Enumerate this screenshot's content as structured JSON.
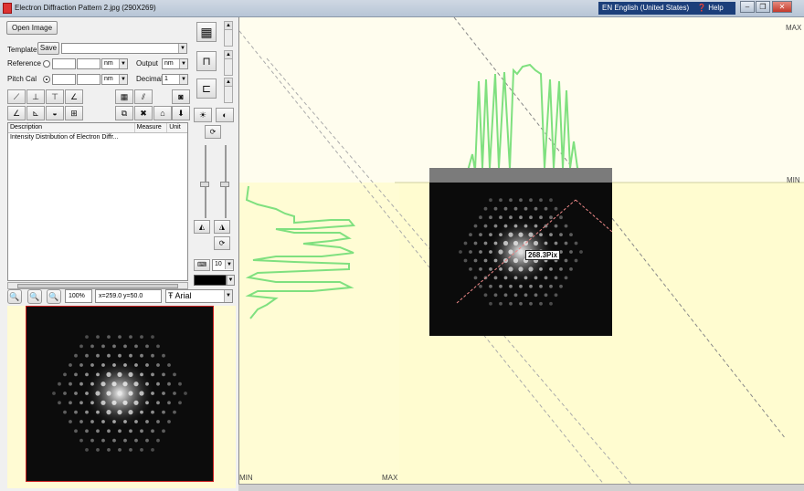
{
  "window": {
    "title": "Electron Diffraction Pattern 2.jpg  (290X269)",
    "language": "EN English (United States)",
    "help": "Help"
  },
  "panel": {
    "open_image": "Open Image",
    "template_label": "Template",
    "save_label": "Save",
    "template_value": "",
    "reference_label": "Reference",
    "reference_unit": "nm",
    "output_label": "Output",
    "output_unit": "nm",
    "pitch_label": "Pitch Cal",
    "pitch_unit": "nm",
    "decimal_label": "Decimal",
    "decimal_value": "1"
  },
  "table": {
    "columns": [
      "Description",
      "Measure",
      "Unit"
    ],
    "rows": [
      {
        "description": "Intensity Distribution of Electron Diffr...",
        "measure": "",
        "unit": ""
      }
    ]
  },
  "zoom": {
    "percent": "100%",
    "coords": "x=259.0 y=50.0",
    "font": "Arial",
    "line_width": "10"
  },
  "canvas": {
    "max_top": "MAX",
    "min_right": "MIN",
    "min_bottom": "MIN",
    "max_bottom": "MAX",
    "measurement": "268.3Pix"
  },
  "colors": {
    "accent": "#1c3f7a",
    "profile": "#7fe07f",
    "canvas_bg": "#fffcd4"
  }
}
